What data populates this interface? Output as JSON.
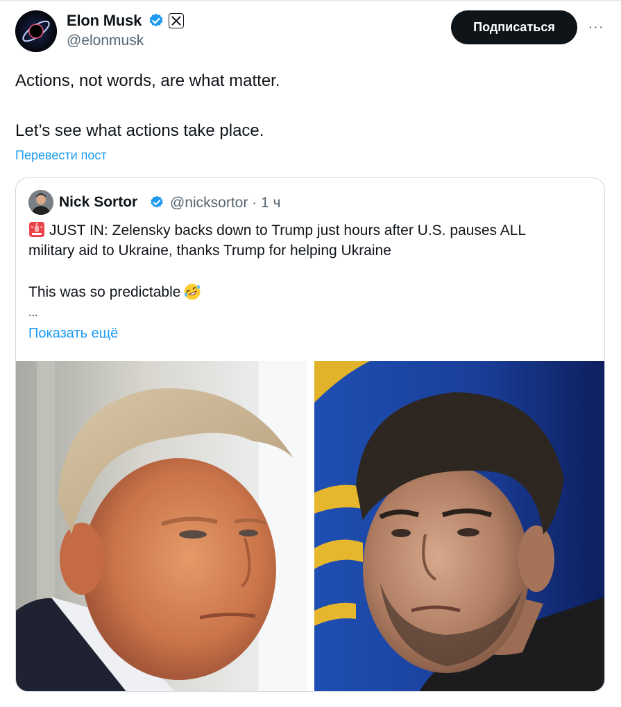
{
  "author": {
    "name": "Elon Musk",
    "handle": "@elonmusk",
    "avatar_icon": "avatar-image"
  },
  "actions": {
    "subscribe_label": "Подписаться",
    "more_label": "···"
  },
  "post": {
    "line1": "Actions, not words, are what matter.",
    "line2": "Let’s see what actions take place.",
    "translate_label": "Перевести пост"
  },
  "quote": {
    "name": "Nick Sortor",
    "meta": "@nicksortor · 1 ч",
    "line1": "JUST IN: Zelensky backs down to Trump just hours after U.S. pauses ALL",
    "line2": "military aid to Ukraine, thanks Trump for helping Ukraine",
    "line3": "This was so predictable",
    "ellipsis": "...",
    "show_more_label": "Показать ещё"
  },
  "colors": {
    "accent": "#1d9bf0",
    "text": "#0f1419",
    "secondary": "#536471",
    "border": "#cfd9de"
  }
}
